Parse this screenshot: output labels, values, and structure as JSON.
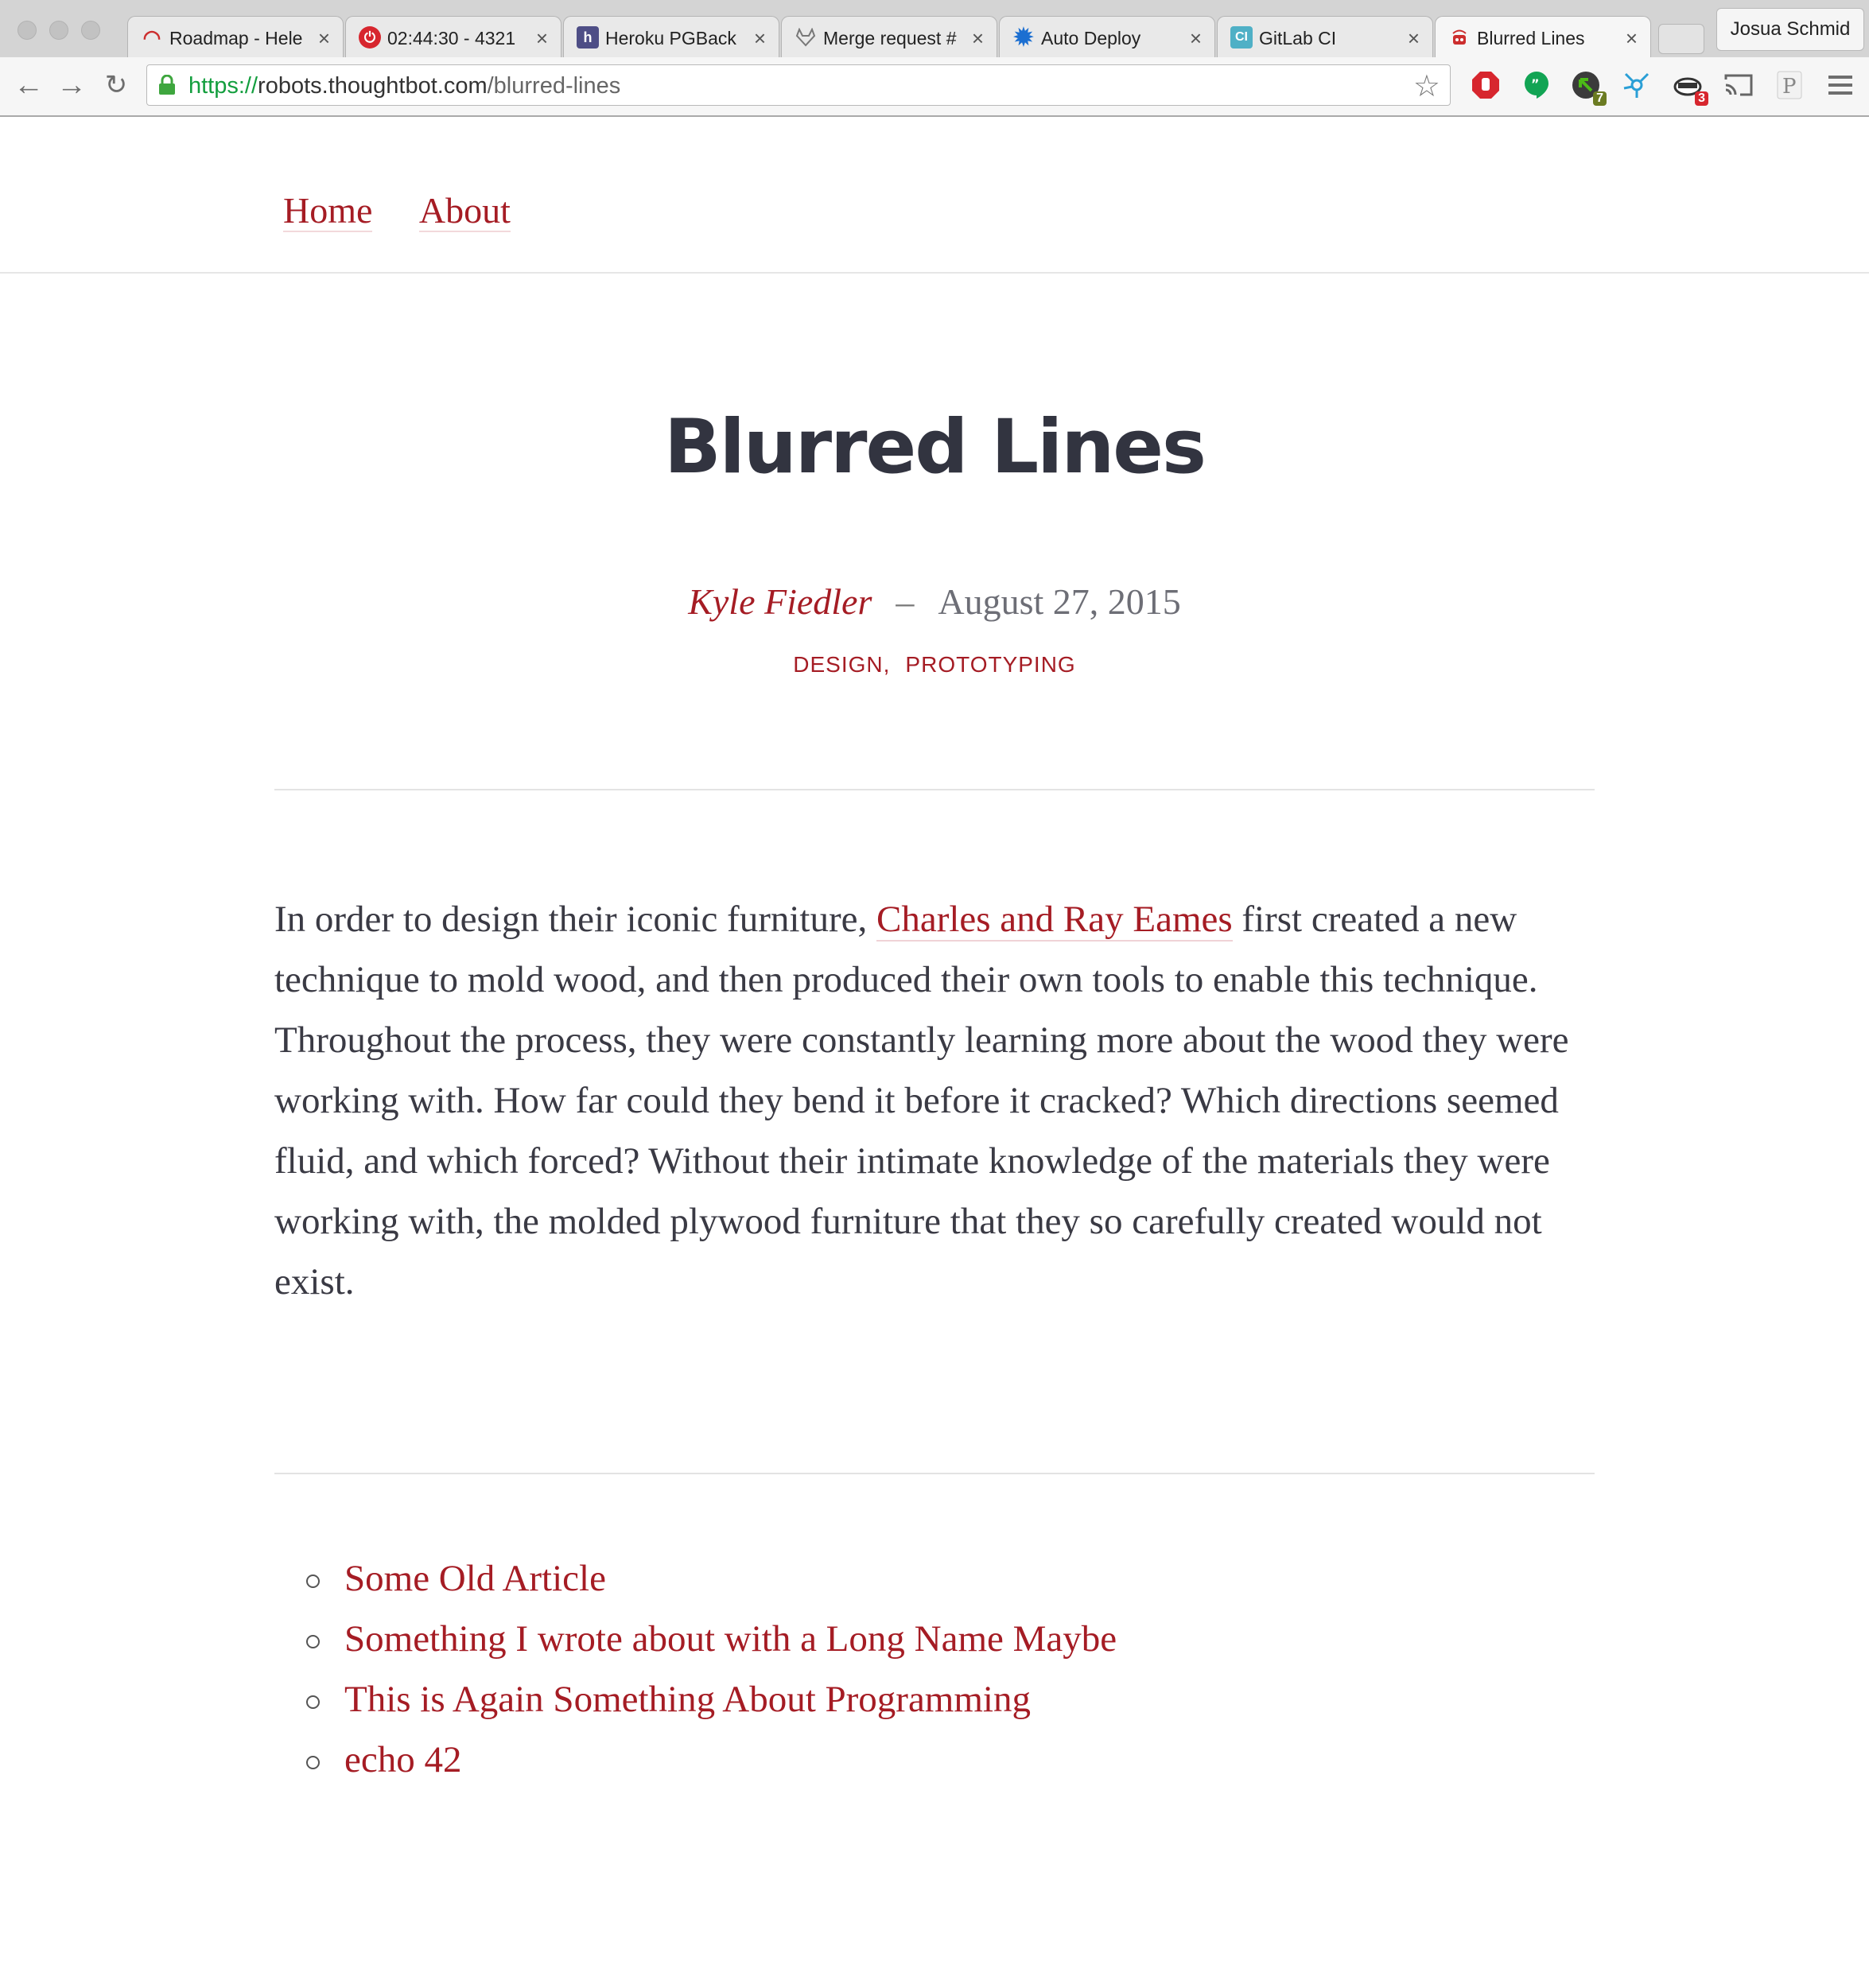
{
  "browser": {
    "tabs": [
      {
        "title": "Roadmap - Hele",
        "icon": "gauge-icon",
        "color": "#cc2e2e"
      },
      {
        "title": "02:44:30 - 4321",
        "icon": "power-icon",
        "color": "#d7262e"
      },
      {
        "title": "Heroku PGBack",
        "icon": "heroku-icon",
        "color": "#4e4e86"
      },
      {
        "title": "Merge request #",
        "icon": "gitlab-fox-icon",
        "color": "#777777"
      },
      {
        "title": "Auto Deploy",
        "icon": "gear-icon",
        "color": "#1c6fd1"
      },
      {
        "title": "GitLab CI",
        "icon": "ci-icon",
        "color": "#4fb0c6"
      },
      {
        "title": "Blurred Lines",
        "icon": "robot-icon",
        "color": "#cc2e2e"
      }
    ],
    "profile_name": "Josua Schmid",
    "url": {
      "scheme": "https://",
      "host": "robots.thoughtbot.com",
      "path": "/blurred-lines"
    },
    "extension_badges": {
      "ext3": "7",
      "ext5": "3"
    }
  },
  "site": {
    "nav": {
      "home": "Home",
      "about": "About"
    }
  },
  "post": {
    "title": "Blurred Lines",
    "author": "Kyle Fiedler",
    "separator": "–",
    "date": "August 27, 2015",
    "tags": [
      "DESIGN",
      "PROTOTYPING"
    ],
    "body": {
      "before_link": "In order to design their iconic furniture, ",
      "link_text": "Charles and Ray Eames",
      "after_link": " first created a new technique to mold wood, and then produced their own tools to enable this technique. Throughout the process, they were constantly learning more about the wood they were working with. How far could they bend it before it cracked? Which directions seemed fluid, and which forced? Without their intimate knowledge of the materials they were working with, the molded plywood furniture that they so carefully created would not exist."
    }
  },
  "related_articles": [
    "Some Old Article",
    "Something I wrote about with a Long Name Maybe",
    "This is Again Something About Programming",
    "echo 42"
  ],
  "colors": {
    "accent": "#a51c24",
    "title": "#323440",
    "body_text": "#3a3a44"
  }
}
